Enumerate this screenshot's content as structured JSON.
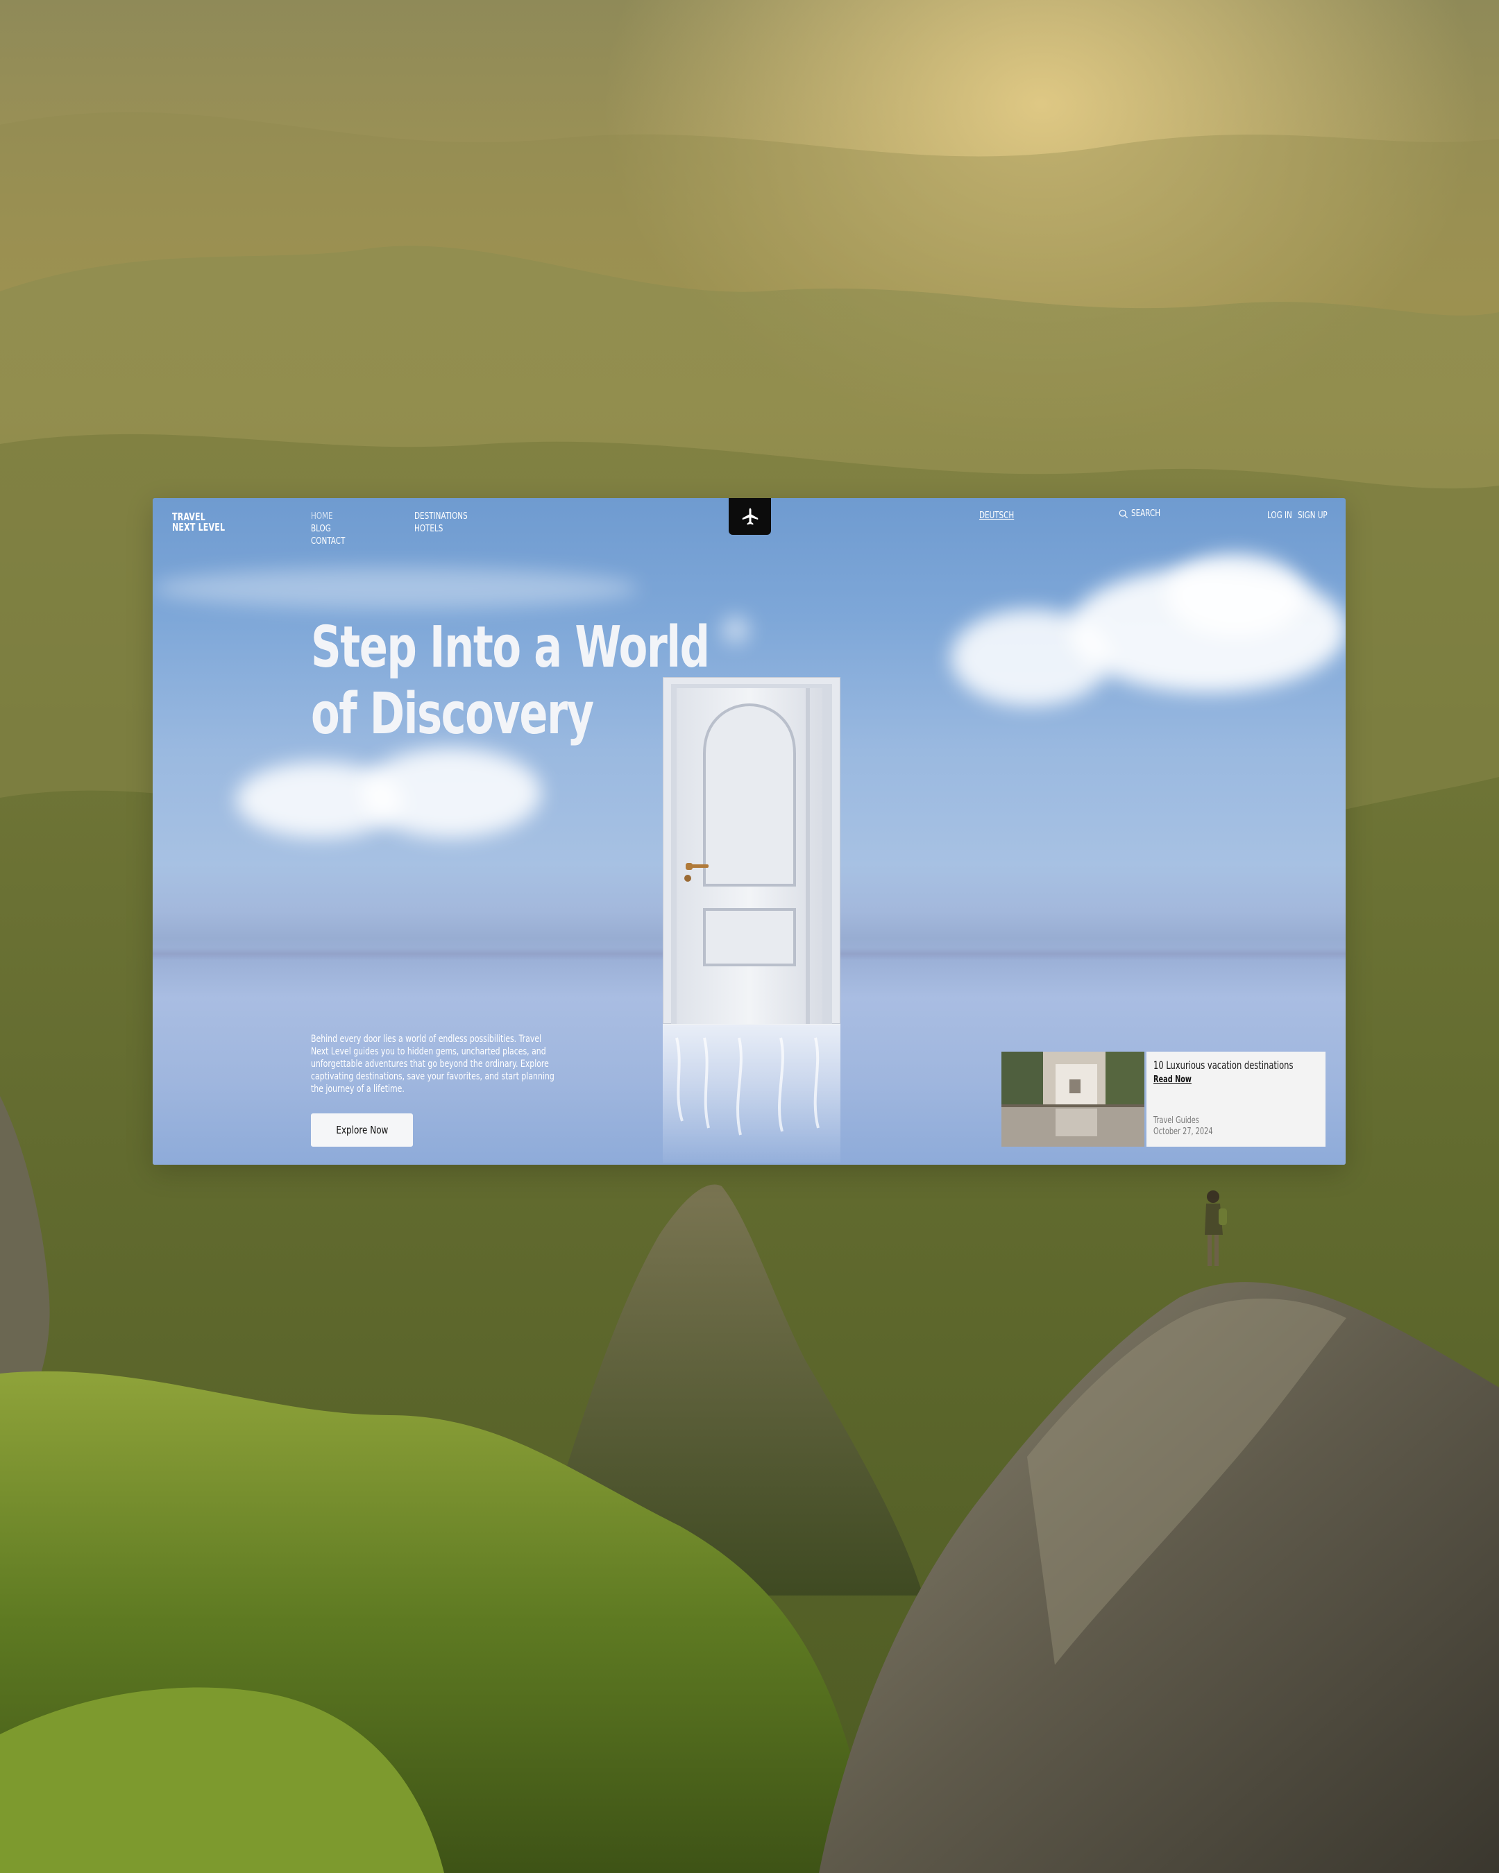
{
  "brand": {
    "line1": "TRAVEL",
    "line2": "NEXT LEVEL"
  },
  "nav": {
    "col1": [
      {
        "label": "HOME"
      },
      {
        "label": "BLOG"
      },
      {
        "label": "CONTACT"
      }
    ],
    "col2": [
      {
        "label": "DESTINATIONS"
      },
      {
        "label": "HOTELS"
      }
    ],
    "language": "DEUTSCH",
    "search_label": "SEARCH",
    "login": "LOG IN",
    "signup": "SIGN UP",
    "logo_icon": "airplane-icon"
  },
  "hero": {
    "headline_line1": "Step Into a World",
    "headline_line2": "of Discovery",
    "description": "Behind every door lies a world of endless possibilities. Travel Next Level guides you to hidden gems, uncharted places, and unforgettable adventures that go beyond the ordinary. Explore captivating destinations, save your favorites, and start planning the journey of a lifetime.",
    "cta": "Explore Now"
  },
  "article": {
    "title": "10 Luxurious vacation destinations",
    "read_link": "Read Now",
    "category": "Travel Guides",
    "date": "October 27, 2024"
  },
  "colors": {
    "sky_blue": "#7ea7d8",
    "logo_bg": "#0c0c0c",
    "card_bg": "#f3f3f3",
    "background_gold": "#a8974f"
  }
}
